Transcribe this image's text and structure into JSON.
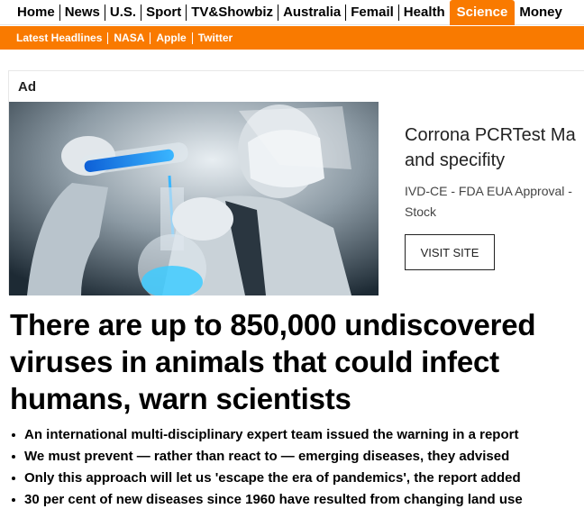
{
  "nav": {
    "items": [
      "Home",
      "News",
      "U.S.",
      "Sport",
      "TV&Showbiz",
      "Australia",
      "Femail",
      "Health",
      "Science",
      "Money"
    ],
    "active": "Science",
    "accent_color": "#f97a00"
  },
  "subnav": {
    "items": [
      "Latest Headlines",
      "NASA",
      "Apple",
      "Twitter"
    ]
  },
  "ad": {
    "label": "Ad",
    "image_icon": "scientist-lab-flask-photo",
    "headline_line1": "Corrona PCRTest Ma",
    "headline_line2": "and specifity",
    "sub_line1": "IVD-CE - FDA EUA Approval -",
    "sub_line2": "Stock",
    "button_label": "VISIT SITE"
  },
  "article": {
    "headline": "There are up to 850,000 undiscovered viruses in animals that could infect humans, warn scientists",
    "bullets": [
      "An international multi-disciplinary expert team issued the warning in a report",
      "We must prevent — rather than react to — emerging diseases, they advised",
      "Only this approach will let us 'escape the era of pandemics', the report added",
      "30 per cent of new diseases since 1960 have resulted from changing land use"
    ]
  }
}
